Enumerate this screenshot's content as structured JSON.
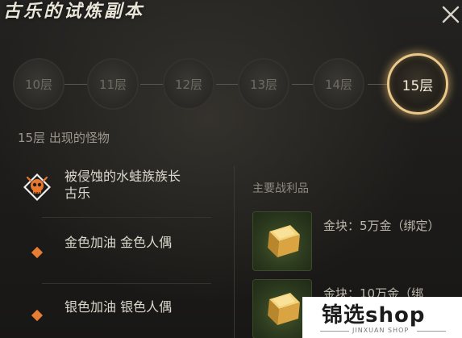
{
  "header": {
    "title": "古乐的试炼副本"
  },
  "floors": [
    {
      "label": "10层",
      "active": false
    },
    {
      "label": "11层",
      "active": false
    },
    {
      "label": "12层",
      "active": false
    },
    {
      "label": "13层",
      "active": false
    },
    {
      "label": "14层",
      "active": false
    },
    {
      "label": "15层",
      "active": true
    }
  ],
  "monsters_section": {
    "title": "15层 出现的怪物",
    "items": [
      {
        "name": "被侵蚀的水蛙族族长 古乐",
        "icon": "skull-icon"
      },
      {
        "name": "金色加油 金色人偶",
        "icon": "diamond-icon"
      },
      {
        "name": "银色加油 银色人偶",
        "icon": "diamond-icon"
      }
    ]
  },
  "loot_section": {
    "title": "主要战利品",
    "items": [
      {
        "text": "金块：5万金（绑定）",
        "icon": "gold-bar-icon"
      },
      {
        "text": "金块：10万金（绑",
        "icon": "gold-bar-icon"
      }
    ]
  },
  "watermark": {
    "brand": "锦选shop",
    "sub": "JINXUAN SHOP"
  },
  "colors": {
    "active_ring": "#e9c88a",
    "diamond": "#e87e33",
    "skull_badge": "#e8782e"
  }
}
